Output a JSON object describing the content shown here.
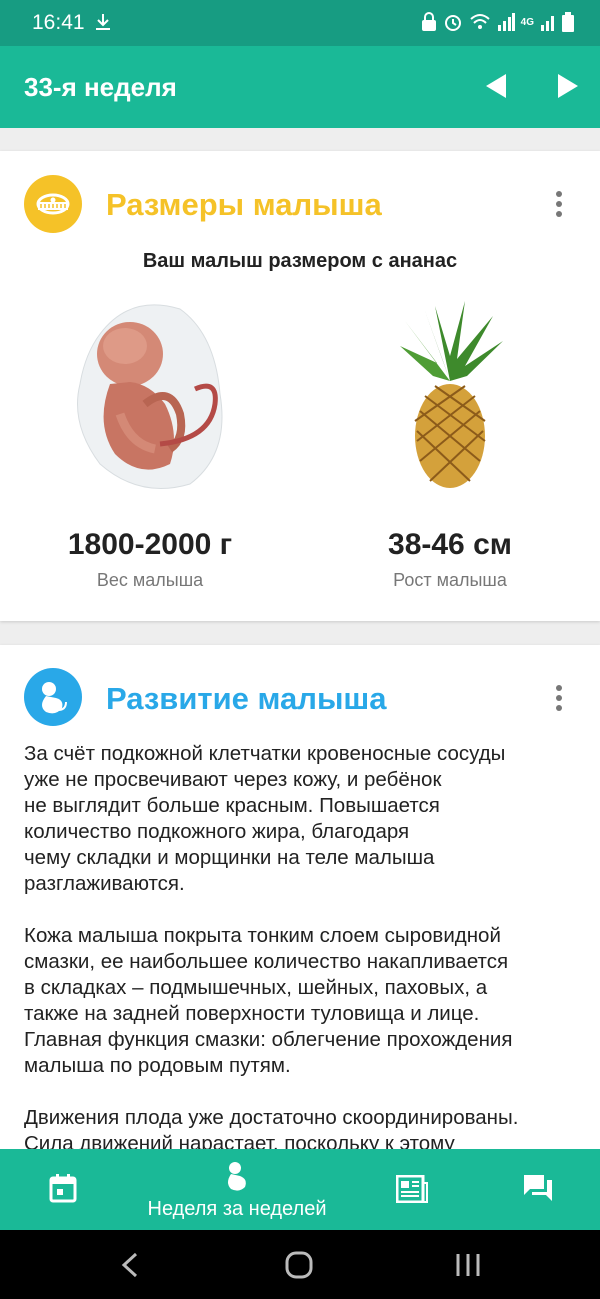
{
  "status_bar": {
    "time": "16:41",
    "network": "4G"
  },
  "app_bar": {
    "title": "33-я неделя"
  },
  "size_card": {
    "title": "Размеры малыша",
    "accent": "#f5c228",
    "subtitle": "Ваш малыш размером с ананас",
    "weight_value": "1800-2000 г",
    "weight_label": "Вес малыша",
    "height_value": "38-46 см",
    "height_label": "Рост малыша"
  },
  "dev_card": {
    "title": "Развитие малыша",
    "accent": "#29a8e8",
    "paragraphs": [
      "За счёт подкожной клетчатки кровеносные сосуды\nуже не просвечивают через кожу, и ребёнок\nне выглядит больше красным. Повышается\nколичество подкожного жира, благодаря\nчему складки и морщинки на теле малыша\nразглаживаются.",
      "Кожа малыша покрыта тонким слоем сыровидной\nсмазки, ее наибольшее количество накапливается\nв складках – подмышечных, шейных, паховых, а\nтакже на задней поверхности туловища и лице.\nГлавная функция смазки: облегчение прохождения\nмалыша по родовым путям.",
      "Движения плода уже достаточно скоординированы.\nСила движений нарастает, поскольку к этому"
    ]
  },
  "bottom_nav": {
    "active_label": "Неделя за неделей"
  },
  "colors": {
    "primary": "#1ab997",
    "status": "#179c82"
  }
}
